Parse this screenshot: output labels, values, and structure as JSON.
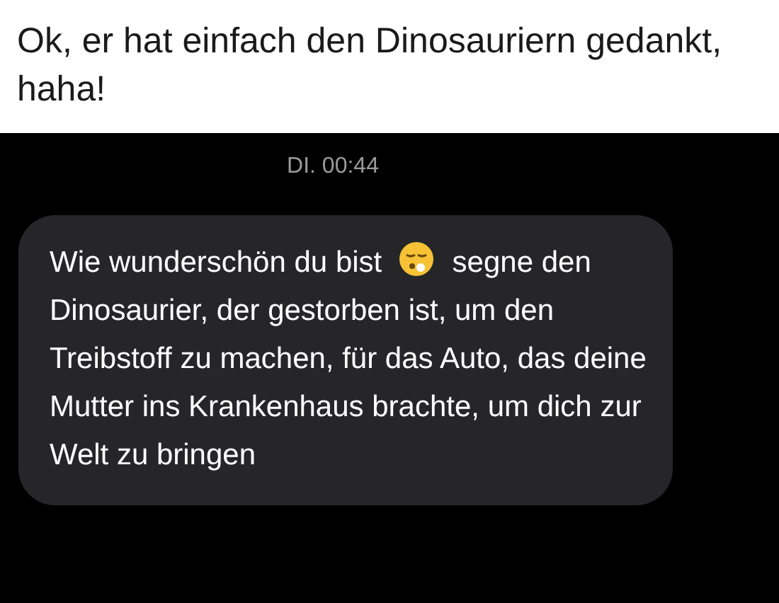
{
  "caption": "Ok, er hat einfach den Dinosauriern gedankt, haha!",
  "timestamp": "DI. 00:44",
  "message": {
    "before_emoji": "Wie wunderschön du bist",
    "after_emoji": "segne den Dinosaurier, der gestorben ist, um den Treibstoff zu machen, für das Auto, das deine Mutter ins Krankenhaus brachte, um dich zur Welt zu bringen"
  }
}
